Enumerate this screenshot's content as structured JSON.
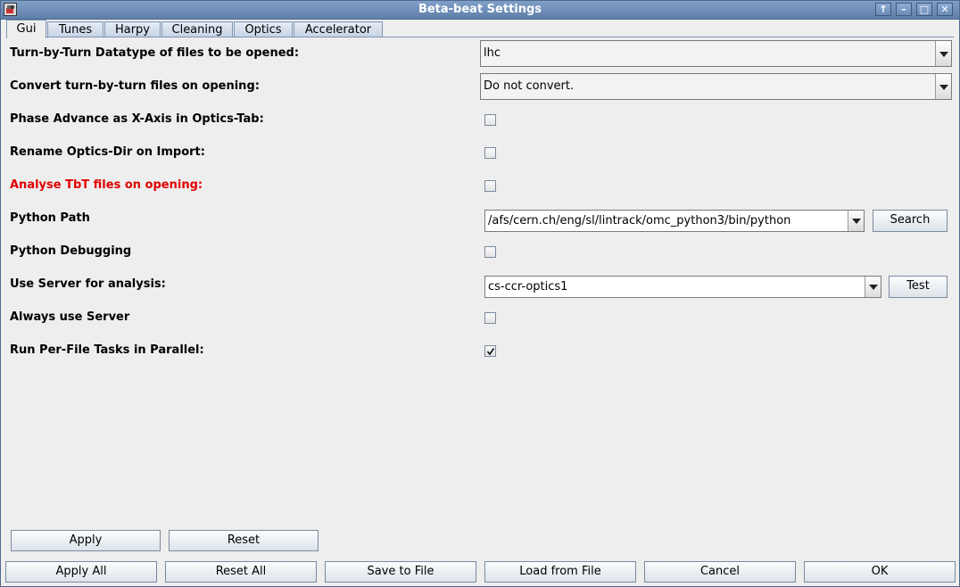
{
  "window": {
    "title": "Beta-beat Settings",
    "controls": [
      "↑",
      "–",
      "□",
      "✕"
    ]
  },
  "tabs": [
    {
      "label": "Gui",
      "active": true
    },
    {
      "label": "Tunes"
    },
    {
      "label": "Harpy"
    },
    {
      "label": "Cleaning"
    },
    {
      "label": "Optics"
    },
    {
      "label": "Accelerator"
    }
  ],
  "rows": {
    "tbt_datatype": {
      "label": "Turn-by-Turn Datatype of files to be opened:",
      "value": "lhc"
    },
    "convert_tbt": {
      "label": "Convert turn-by-turn files on opening:",
      "value": "Do not convert."
    },
    "phase_advance": {
      "label": "Phase Advance as X-Axis in Optics-Tab:",
      "checked": false
    },
    "rename_optics": {
      "label": "Rename Optics-Dir on Import:",
      "checked": false
    },
    "analyse_tbt": {
      "label": "Analyse TbT files on opening:",
      "checked": false,
      "color": "#e00000"
    },
    "python_path": {
      "label": "Python Path",
      "value": "/afs/cern.ch/eng/sl/lintrack/omc_python3/bin/python",
      "button": "Search"
    },
    "python_debugging": {
      "label": "Python Debugging",
      "checked": false
    },
    "use_server": {
      "label": "Use Server for analysis:",
      "value": "cs-ccr-optics1",
      "button": "Test"
    },
    "always_server": {
      "label": "Always use Server",
      "checked": false
    },
    "run_parallel": {
      "label": "Run Per-File Tasks in Parallel:",
      "checked": true
    }
  },
  "buttons": {
    "apply": "Apply",
    "reset": "Reset",
    "apply_all": "Apply All",
    "reset_all": "Reset All",
    "save_to_file": "Save to File",
    "load_from_file": "Load from File",
    "cancel": "Cancel",
    "ok": "OK"
  }
}
